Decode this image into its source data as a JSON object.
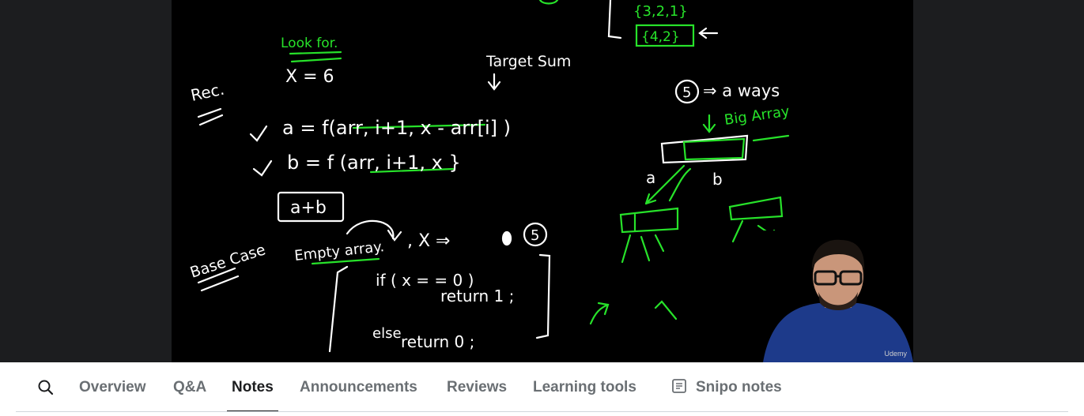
{
  "video": {
    "board": {
      "top_set_1": "{3,2,1}",
      "top_set_2": "{4,2}",
      "look_for": "Look for.",
      "x_eq": "X = 6",
      "target_sum": "Target Sum",
      "rec": "Rec.",
      "eq_a": "a = f(arr, i+1, x - arr[i] )",
      "eq_b": "b = f (arr, i+1, x }",
      "a_plus_b": "a+b",
      "circle_5": "5",
      "ways": "⇒ a  ways",
      "big_array": "Big Array",
      "branch_a": "a",
      "branch_b": "b",
      "base_case": "Base Case",
      "empty_array": "Empty array.",
      "x_arrow": ",  X ⇒",
      "circle_5b": "5",
      "if_line": "if ( x = = 0 )",
      "return_1": "return 1 ;",
      "else_line": "else",
      "return_0": "return 0 ;"
    },
    "watermark": "Udemy"
  },
  "tabs": {
    "search_icon": "search-icon",
    "items": [
      {
        "label": "Overview"
      },
      {
        "label": "Q&A"
      },
      {
        "label": "Notes"
      },
      {
        "label": "Announcements"
      },
      {
        "label": "Reviews"
      },
      {
        "label": "Learning tools"
      },
      {
        "label": "Snipo notes",
        "icon": "notes-icon"
      }
    ],
    "active": "Notes"
  },
  "colors": {
    "ink_white": "#ffffff",
    "ink_green": "#27e22a",
    "frame_bg": "#000000",
    "page_bg": "#1c1d1f",
    "tab_active": "#1c1d1f",
    "tab_inactive": "#6a6f73"
  }
}
